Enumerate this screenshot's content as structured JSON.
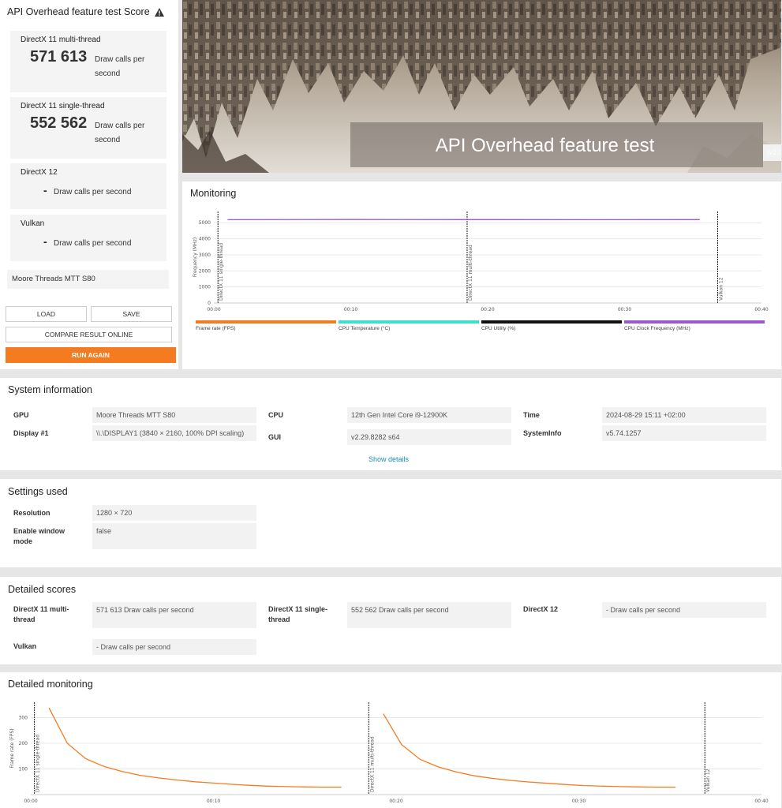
{
  "score_panel": {
    "title": "API Overhead feature test Score",
    "items": [
      {
        "label": "DirectX 11 multi-thread",
        "value": "571 613",
        "unit": "Draw calls per second"
      },
      {
        "label": "DirectX 11 single-thread",
        "value": "552 562",
        "unit": "Draw calls per second"
      },
      {
        "label": "DirectX 12",
        "value": "-",
        "unit": "Draw calls per second"
      },
      {
        "label": "Vulkan",
        "value": "-",
        "unit": "Draw calls per second"
      }
    ],
    "gpu": "Moore Threads MTT S80",
    "buttons": {
      "load": "LOAD",
      "save": "SAVE",
      "compare": "COMPARE RESULT ONLINE",
      "run": "RUN AGAIN"
    }
  },
  "hero": {
    "title": "API Overhead feature test",
    "version": "(v2.0)"
  },
  "monitoring": {
    "title": "Monitoring",
    "chart_data": {
      "type": "line",
      "ylabel": "Frequency (MHz)",
      "yticks": [
        0,
        1000,
        2000,
        3000,
        4000,
        5000
      ],
      "ylim": [
        0,
        5700
      ],
      "xticks": [
        "00:00",
        "00:10",
        "00:20",
        "00:30",
        "00:40"
      ],
      "xlim": [
        0,
        40
      ],
      "markers": [
        {
          "x": 0.3,
          "label": "DirectX 11 single-thread"
        },
        {
          "x": 18.5,
          "label": "DirectX 11 multi-thread"
        },
        {
          "x": 36.8,
          "label": "Vulkan 12"
        }
      ],
      "series": [
        {
          "name": "CPU Clock Frequency (MHz)",
          "color": "#9b59d0",
          "x": [
            1,
            10,
            18.5,
            27,
            35.5
          ],
          "values": [
            5190,
            5200,
            5195,
            5190,
            5195
          ]
        }
      ],
      "legend": [
        {
          "name": "Frame rate (FPS)",
          "color": "#f47b20"
        },
        {
          "name": "CPU Temperature (°C)",
          "color": "#3de0c8"
        },
        {
          "name": "CPU Utility (%)",
          "color": "#111111"
        },
        {
          "name": "CPU Clock Frequency (MHz)",
          "color": "#9b59d0"
        }
      ]
    }
  },
  "system_info": {
    "title": "System information",
    "rows": [
      {
        "key": "GPU",
        "value": "Moore Threads MTT S80"
      },
      {
        "key": "Display #1",
        "value": "\\\\.\\DISPLAY1 (3840 × 2160, 100% DPI scaling)"
      },
      {
        "key": "CPU",
        "value": "12th Gen Intel Core i9-12900K"
      },
      {
        "key": "GUI",
        "value": "v2.29.8282 s64"
      },
      {
        "key": "Time",
        "value": "2024-08-29 15:11 +02:00"
      },
      {
        "key": "SystemInfo",
        "value": "v5.74.1257"
      }
    ],
    "show_details": "Show details"
  },
  "settings": {
    "title": "Settings used",
    "rows": [
      {
        "key": "Resolution",
        "value": "1280 × 720"
      },
      {
        "key": "Enable window mode",
        "value": "false"
      }
    ]
  },
  "detailed_scores": {
    "title": "Detailed scores",
    "rows": [
      {
        "key": "DirectX 11 multi-thread",
        "value": "571 613 Draw calls per second"
      },
      {
        "key": "DirectX 11 single-thread",
        "value": "552 562 Draw calls per second"
      },
      {
        "key": "DirectX 12",
        "value": "- Draw calls per second"
      },
      {
        "key": "Vulkan",
        "value": "- Draw calls per second"
      }
    ]
  },
  "detailed_monitoring": {
    "title": "Detailed monitoring",
    "chart_data": {
      "type": "line",
      "ylabel": "Frame rate (FPS)",
      "yticks": [
        100,
        200,
        300
      ],
      "ylim": [
        0,
        360
      ],
      "xticks": [
        "00:00",
        "00:10",
        "00:20",
        "00:30",
        "00:40"
      ],
      "xlim": [
        0,
        40
      ],
      "markers": [
        {
          "x": 0.2,
          "label": "DirectX 11 single-thread"
        },
        {
          "x": 18.5,
          "label": "DirectX 11 multi-thread"
        },
        {
          "x": 36.9,
          "label": "Vulkan 12"
        }
      ],
      "series": [
        {
          "name": "Frame rate (FPS) segment 1",
          "color": "#f47b20",
          "x": [
            1,
            2,
            3,
            4,
            5,
            6,
            7,
            8,
            9,
            10,
            11,
            12,
            13,
            14,
            15,
            16,
            17
          ],
          "values": [
            338,
            200,
            140,
            110,
            90,
            75,
            65,
            57,
            50,
            45,
            40,
            36,
            33,
            31,
            30,
            29,
            29
          ]
        },
        {
          "name": "Frame rate (FPS) segment 2",
          "color": "#f47b20",
          "x": [
            19.3,
            20.3,
            21.3,
            22.3,
            23.3,
            24.3,
            25.3,
            26.3,
            27.3,
            28.3,
            29.3,
            30.3,
            31.3,
            32.3,
            33.3,
            34.3,
            35.3
          ],
          "values": [
            315,
            195,
            138,
            108,
            88,
            73,
            63,
            55,
            49,
            44,
            39,
            35,
            33,
            31,
            30,
            29,
            29
          ]
        }
      ]
    }
  }
}
